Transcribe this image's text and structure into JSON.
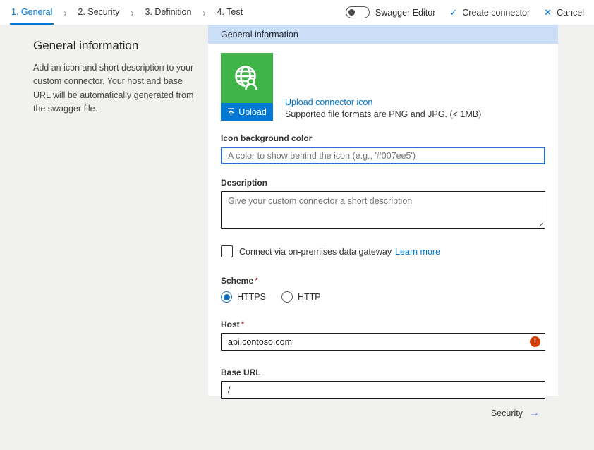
{
  "nav": {
    "steps": [
      {
        "label": "1. General",
        "active": true
      },
      {
        "label": "2. Security",
        "active": false
      },
      {
        "label": "3. Definition",
        "active": false
      },
      {
        "label": "4. Test",
        "active": false
      }
    ],
    "swagger_toggle": {
      "label": "Swagger Editor",
      "state": "off"
    },
    "create_connector_label": "Create connector",
    "create_connector_icon": "✓",
    "cancel_label": "Cancel",
    "cancel_icon": "✕"
  },
  "sidebar": {
    "title": "General information",
    "description": "Add an icon and short description to your custom connector. Your host and base URL will be automatically generated from the swagger file."
  },
  "panel": {
    "header": "General information",
    "upload": {
      "button_label": "Upload",
      "link_label": "Upload connector icon",
      "hint": "Supported file formats are PNG and JPG. (< 1MB)"
    },
    "fields": {
      "icon_bg": {
        "label": "Icon background color",
        "placeholder": "A color to show behind the icon (e.g., '#007ee5')"
      },
      "description": {
        "label": "Description",
        "placeholder": "Give your custom connector a short description"
      },
      "gateway": {
        "label": "Connect via on-premises data gateway",
        "link": "Learn more",
        "checked": false
      },
      "scheme": {
        "label": "Scheme",
        "required_marker": "*",
        "options": [
          {
            "label": "HTTPS",
            "selected": true
          },
          {
            "label": "HTTP",
            "selected": false
          }
        ]
      },
      "host": {
        "label": "Host",
        "required_marker": "*",
        "value": "api.contoso.com",
        "error": true,
        "error_glyph": "!"
      },
      "base_url": {
        "label": "Base URL",
        "value": "/"
      }
    },
    "footer": {
      "next_label": "Security",
      "arrow": "→"
    }
  },
  "colors": {
    "accent": "#0078d4",
    "tile-green": "#3eb449",
    "header-blue": "#cbdef7",
    "error-red": "#d83b01",
    "focus-border": "#2b6cd4",
    "next-arrow": "#7d90e8"
  }
}
